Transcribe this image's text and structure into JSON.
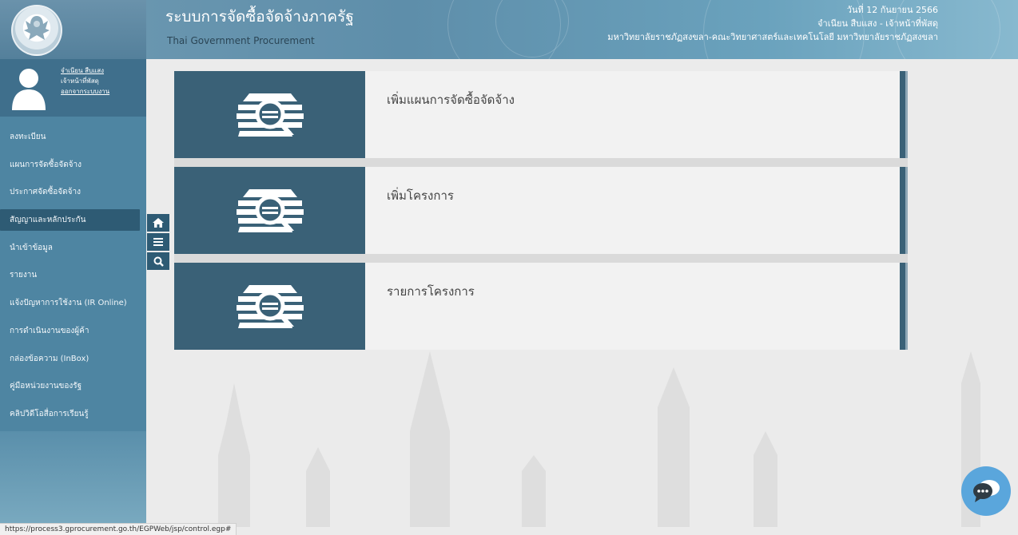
{
  "header": {
    "title": "ระบบการจัดซื้อจัดจ้างภาครัฐ",
    "subtitle": "Thai Government Procurement",
    "date": "วันที่ 12 กันยายน 2566",
    "user_role": "จำเนียน สืบแสง - เจ้าหน้าที่พัสดุ",
    "organization": "มหาวิทยาลัยราชภัฏสงขลา-คณะวิทยาศาสตร์และเทคโนโลยี มหาวิทยาลัยราชภัฏสงขลา"
  },
  "profile": {
    "name": "จำเนียน สืบแสง",
    "role": "เจ้าหน้าที่พัสดุ",
    "logout": "ออกจากระบบงาน"
  },
  "sidebar": {
    "items": [
      {
        "label": "ลงทะเบียน",
        "active": false
      },
      {
        "label": "แผนการจัดซื้อจัดจ้าง",
        "active": false
      },
      {
        "label": "ประกาศจัดซื้อจัดจ้าง",
        "active": false
      },
      {
        "label": "สัญญาและหลักประกัน",
        "active": true
      },
      {
        "label": "นำเข้าข้อมูล",
        "active": false
      },
      {
        "label": "รายงาน",
        "active": false
      },
      {
        "label": "แจ้งปัญหาการใช้งาน (IR Online)",
        "active": false
      },
      {
        "label": "การดำเนินงานของผู้ค้า",
        "active": false
      },
      {
        "label": "กล่องข้อความ (InBox)",
        "active": false
      },
      {
        "label": "คู่มือหน่วยงานของรัฐ",
        "active": false
      },
      {
        "label": "คลิปวิดีโอสื่อการเรียนรู้",
        "active": false
      }
    ]
  },
  "toolbar": {
    "icons": [
      "home-icon",
      "menu-icon",
      "search-icon"
    ]
  },
  "cards": [
    {
      "label": "เพิ่มแผนการจัดซื้อจัดจ้าง",
      "icon": "document-search-icon"
    },
    {
      "label": "เพิ่มโครงการ",
      "icon": "document-search-icon"
    },
    {
      "label": "รายการโครงการ",
      "icon": "document-search-icon"
    }
  ],
  "status_url": "https://process3.gprocurement.go.th/EGPWeb/jsp/control.egp#",
  "colors": {
    "header": "#5e8eaa",
    "sidebar": "#4e85a2",
    "card_icon_bg": "#3a6177",
    "active_menu": "#2e5b74",
    "chat_button": "#5aa6dc"
  }
}
